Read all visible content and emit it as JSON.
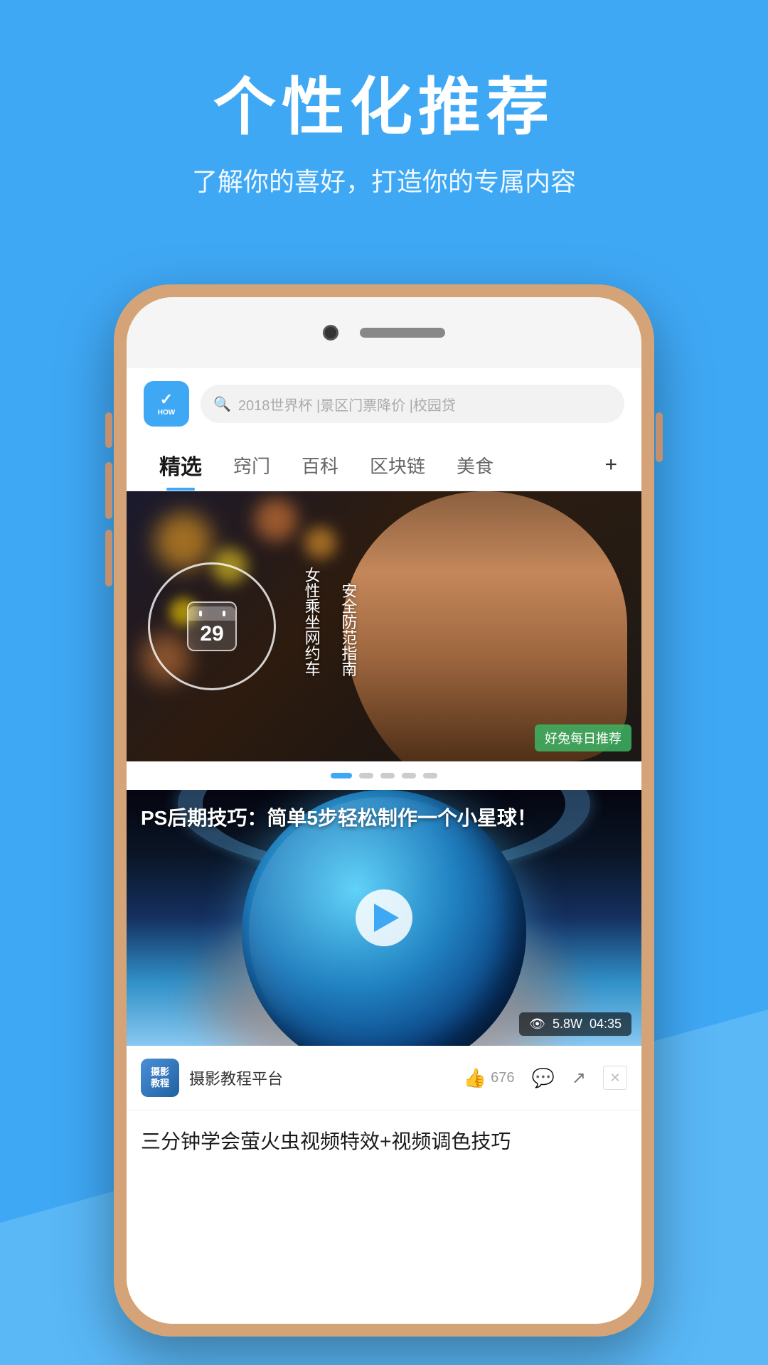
{
  "page": {
    "background_color": "#3fa8f5"
  },
  "header": {
    "title": "个性化推荐",
    "subtitle": "了解你的喜好，打造你的专属内容"
  },
  "app": {
    "logo": {
      "symbol": "✓",
      "text": "HOW",
      "bg_color": "#3fa8f5"
    },
    "search": {
      "placeholder": "2018世界杯 |景区门票降价 |校园贷"
    },
    "nav_tabs": [
      {
        "label": "精选",
        "active": true
      },
      {
        "label": "窍门",
        "active": false
      },
      {
        "label": "百科",
        "active": false
      },
      {
        "label": "区块链",
        "active": false
      },
      {
        "label": "美食",
        "active": false
      }
    ],
    "nav_plus": "+",
    "banner": {
      "calendar_date": "29",
      "text_line1": "女性乘坐网约车",
      "text_line2": "安全防范指南",
      "tag": "好兔每日推荐",
      "dots": [
        true,
        false,
        false,
        false,
        false
      ]
    },
    "video_card": {
      "title": "PS后期技巧：简单5步轻松制作一个小星球！",
      "views": "5.8W",
      "duration": "04:35",
      "author": "摄影教程平台",
      "avatar_text": "摄影\n教程",
      "likes": "676",
      "has_comment": true,
      "has_share": true,
      "has_close": true
    },
    "next_article": {
      "title": "三分钟学会萤火虫视频特效+视频调色技巧"
    }
  },
  "icons": {
    "search": "🔍",
    "play": "▶",
    "like": "👍",
    "comment": "💬",
    "share": "↗",
    "close": "✕",
    "eye": "👁"
  }
}
